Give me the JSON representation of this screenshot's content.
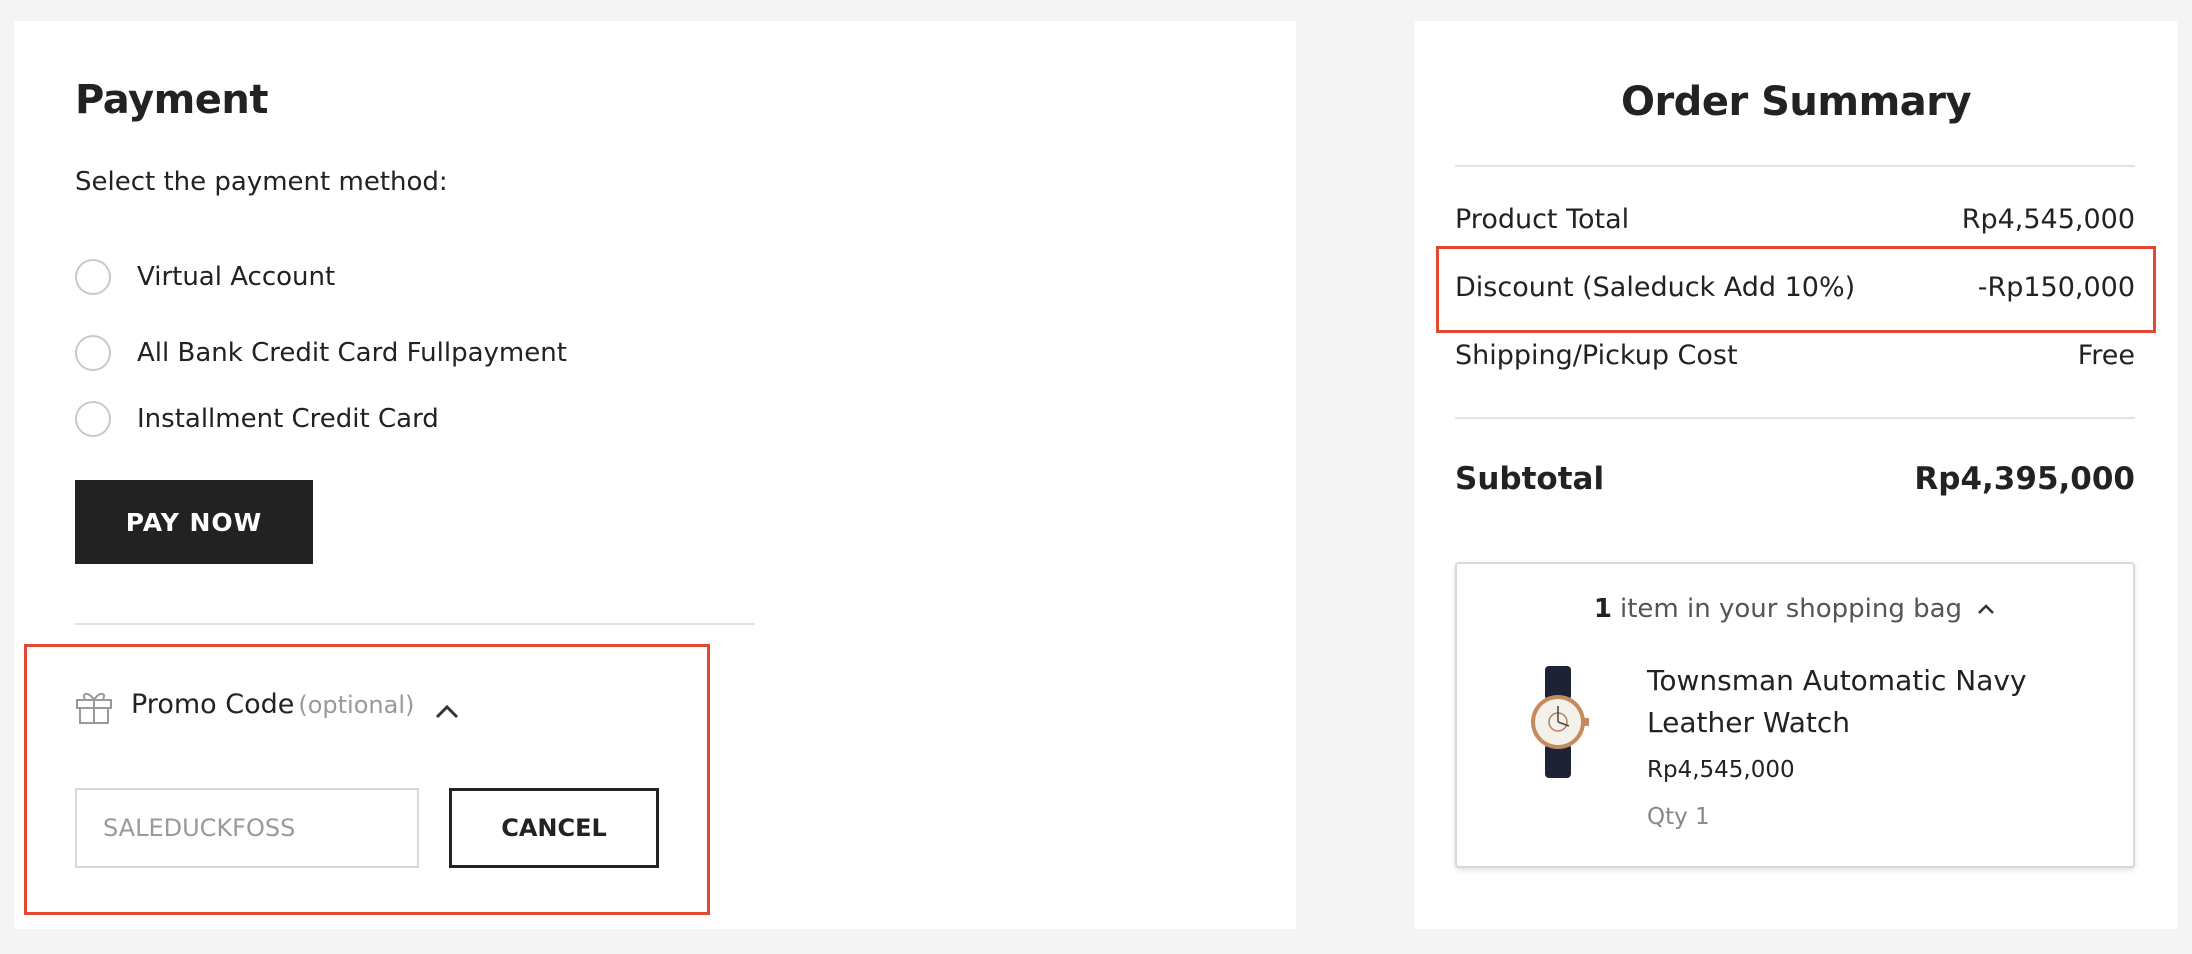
{
  "payment": {
    "title": "Payment",
    "subtitle": "Select the payment method:",
    "methods": [
      {
        "label": "Virtual Account",
        "selected": false
      },
      {
        "label": "All Bank Credit Card Fullpayment",
        "selected": false
      },
      {
        "label": "Installment Credit Card",
        "selected": false
      }
    ],
    "pay_button": "PAY NOW"
  },
  "promo": {
    "label": "Promo Code",
    "optional": "(optional)",
    "input_value": "SALEDUCKFOSS",
    "cancel_button": "CANCEL"
  },
  "summary": {
    "title": "Order Summary",
    "product_total_label": "Product Total",
    "product_total_value": "Rp4,545,000",
    "discount_label": "Discount (Saleduck Add 10%)",
    "discount_value": "-Rp150,000",
    "shipping_label": "Shipping/Pickup Cost",
    "shipping_value": "Free",
    "subtotal_label": "Subtotal",
    "subtotal_value": "Rp4,395,000"
  },
  "bag": {
    "count": "1",
    "label": "item in your shopping bag",
    "item": {
      "name": "Townsman Automatic Navy Leather Watch",
      "price": "Rp4,545,000",
      "qty": "Qty 1"
    }
  },
  "colors": {
    "highlight": "#e04a33",
    "button_dark": "#222222"
  }
}
